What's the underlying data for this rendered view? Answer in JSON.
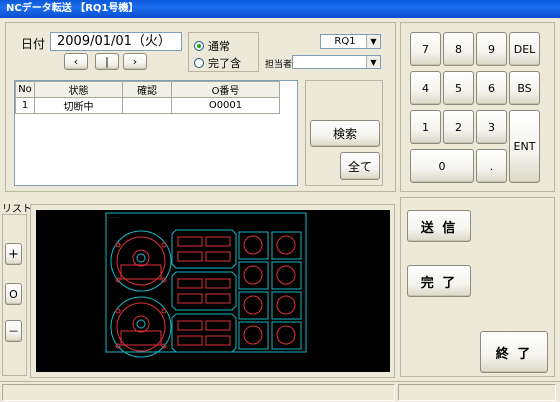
{
  "window": {
    "title": "NCデータ転送 【RQ1号機】"
  },
  "date_section": {
    "label": "日付",
    "value": "2009/01/01（火）",
    "nav_prev": "‹",
    "nav_mid": "|",
    "nav_next": "›"
  },
  "filter": {
    "options": [
      {
        "label": "通常",
        "selected": true
      },
      {
        "label": "完了含",
        "selected": false
      }
    ]
  },
  "machine_select": {
    "value": "RQ1"
  },
  "person_select": {
    "label": "担当者",
    "value": ""
  },
  "job_table": {
    "columns": [
      "No",
      "状態",
      "確認",
      "O番号"
    ],
    "rows": [
      {
        "no": "1",
        "status": "切断中",
        "confirm": "",
        "o_number": "O0001"
      }
    ]
  },
  "search_panel": {
    "search_label": "検索",
    "all_label": "全て"
  },
  "keypad": {
    "keys": [
      "7",
      "8",
      "9",
      "DEL",
      "4",
      "5",
      "6",
      "BS",
      "1",
      "2",
      "3",
      "ENT",
      "0",
      "."
    ]
  },
  "list_panel": {
    "label": "リスト",
    "plus": "+",
    "zero": "O",
    "minus": "－"
  },
  "actions": {
    "send": "送 信",
    "complete": "完 了",
    "exit": "終 了"
  },
  "colors": {
    "title_bar": "#0a58d8",
    "preview_bg": "#000000",
    "drawing_cyan": "#19b6c6",
    "drawing_red": "#e0303a"
  }
}
